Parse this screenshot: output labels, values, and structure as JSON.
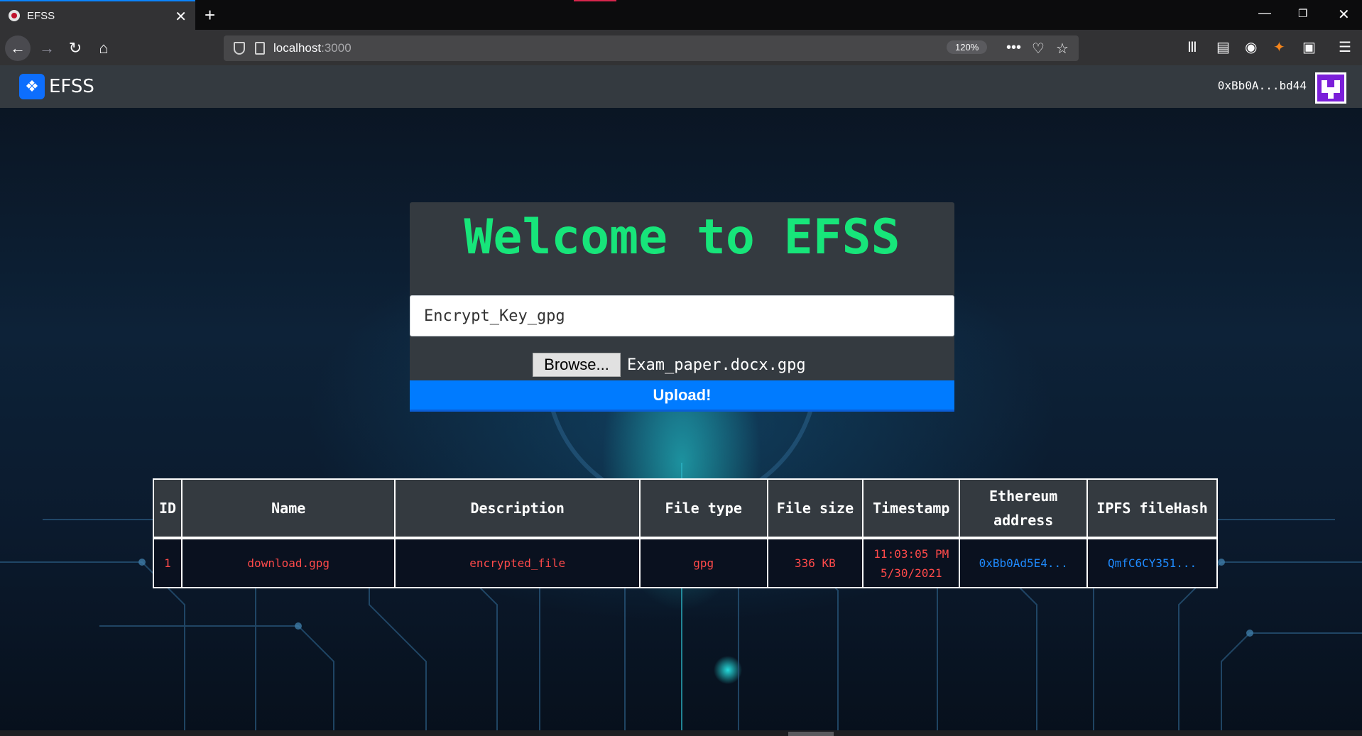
{
  "browser": {
    "tab_title": "EFSS",
    "url_host": "localhost",
    "url_port": ":3000",
    "zoom": "120%",
    "accent": "#0a84ff"
  },
  "navbar": {
    "brand": "EFSS",
    "brand_icon": "dropbox-icon",
    "account": "0xBb0A...bd44",
    "background": "#343a40"
  },
  "upload_card": {
    "heading": "Welcome to EFSS",
    "heading_color": "#17e57a",
    "description_value": "Encrypt_Key_gpg",
    "browse_label": "Browse...",
    "selected_file": "Exam_paper.docx.gpg",
    "upload_label": "Upload!",
    "upload_color": "#007bff"
  },
  "table": {
    "headers": [
      "ID",
      "Name",
      "Description",
      "File type",
      "File size",
      "Timestamp",
      "Ethereum address",
      "IPFS fileHash"
    ],
    "rows": [
      {
        "id": "1",
        "name": "download.gpg",
        "description": "encrypted_file",
        "type": "gpg",
        "size": "336 KB",
        "timestamp_time": "11:03:05 PM",
        "timestamp_date": "5/30/2021",
        "address": "0xBb0Ad5E4...",
        "hash": "QmfC6CY351..."
      }
    ],
    "row_text_color": "#ff4a4a",
    "link_color": "#1f8bff"
  }
}
